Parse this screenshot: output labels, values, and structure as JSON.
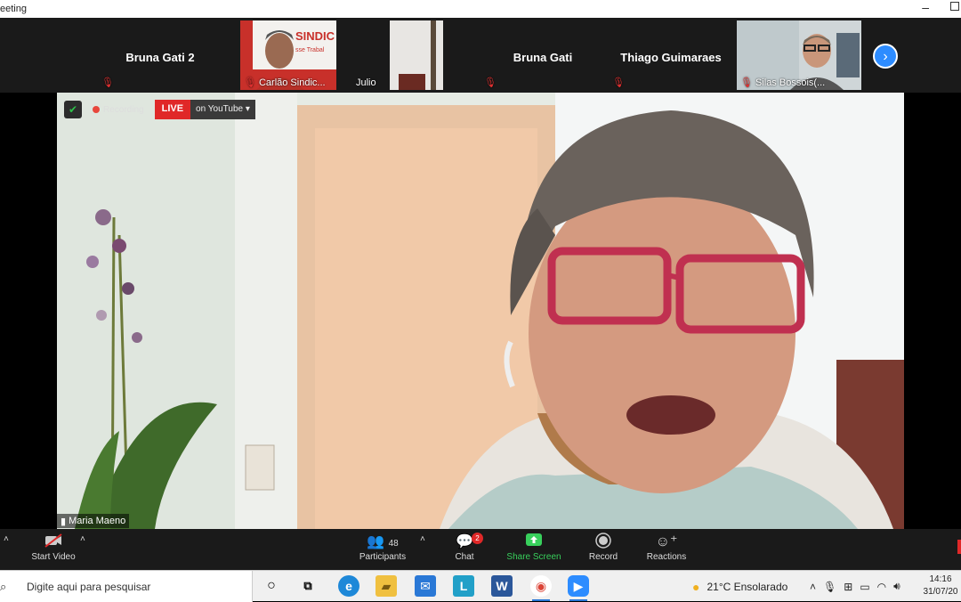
{
  "window": {
    "title": "eeting"
  },
  "strip": {
    "tiles": [
      {
        "name": "Bruna Gati 2",
        "label_style": "center",
        "muted": true
      },
      {
        "name": "Carlão Sindic...",
        "label_style": "corner",
        "muted": true,
        "sign": "SINDIC",
        "sign2": "sse Trabal"
      },
      {
        "name": "Julio",
        "label_style": "corner",
        "muted": false
      },
      {
        "name": "Bruna Gati",
        "label_style": "center",
        "muted": true
      },
      {
        "name": "Thiago Guimaraes",
        "label_style": "center",
        "muted": true
      },
      {
        "name": "Silas Bossois(...",
        "label_style": "corner",
        "muted": true
      }
    ],
    "next_icon": "chevron-right-icon"
  },
  "overlay": {
    "recording_label": "Recording",
    "live_label": "LIVE",
    "youtube_label": "on YouTube"
  },
  "main": {
    "speaker_name": "Maria Maeno"
  },
  "toolbar": {
    "start_video": "Start Video",
    "participants": "Participants",
    "participants_count": "48",
    "chat": "Chat",
    "chat_badge": "2",
    "share_screen": "Share Screen",
    "record": "Record",
    "reactions": "Reactions"
  },
  "taskbar": {
    "search_placeholder": "Digite aqui para pesquisar",
    "weather": "21°C  Ensolarado",
    "time": "14:16",
    "date": "31/07/20"
  },
  "colors": {
    "accent": "#2d8cff",
    "live": "#e02828",
    "share": "#38d05c"
  }
}
